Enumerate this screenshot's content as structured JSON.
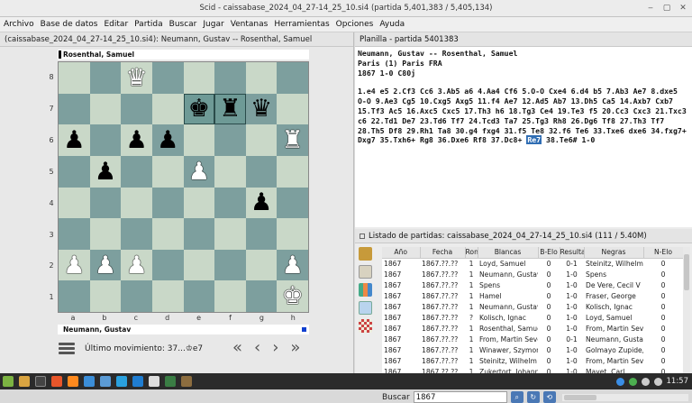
{
  "window": {
    "title": "Scid - caissabase_2024_04_27-14_25_10.si4 (partida 5,401,383 / 5,405,134)"
  },
  "menu": [
    "Archivo",
    "Base de datos",
    "Editar",
    "Partida",
    "Buscar",
    "Jugar",
    "Ventanas",
    "Herramientas",
    "Opciones",
    "Ayuda"
  ],
  "board_pane": {
    "tab": "(caissabase_2024_04_27-14_25_10.si4): Neumann, Gustav -- Rosenthal, Samuel",
    "black_player": "Rosenthal, Samuel",
    "white_player": "Neumann, Gustav",
    "ranks": [
      "8",
      "7",
      "6",
      "5",
      "4",
      "3",
      "2",
      "1"
    ],
    "files": [
      "a",
      "b",
      "c",
      "d",
      "e",
      "f",
      "g",
      "h"
    ],
    "last_move_label": "Último movimiento: 37...♔e7",
    "position": [
      [
        "",
        "",
        "wQ",
        "",
        "",
        "",
        "",
        ""
      ],
      [
        "",
        "",
        "",
        "",
        "bK",
        "bR",
        "bQ",
        ""
      ],
      [
        "bP",
        "",
        "bP",
        "bP",
        "",
        "",
        "",
        "wR"
      ],
      [
        "",
        "bP",
        "",
        "",
        "wP",
        "",
        "",
        ""
      ],
      [
        "",
        "",
        "",
        "",
        "",
        "",
        "bP",
        ""
      ],
      [
        "",
        "",
        "",
        "",
        "",
        "",
        "",
        ""
      ],
      [
        "wP",
        "wP",
        "wP",
        "",
        "",
        "",
        "",
        "wP"
      ],
      [
        "",
        "",
        "",
        "",
        "",
        "",
        "",
        "wK"
      ]
    ]
  },
  "notation": {
    "tab": "Planilla - partida 5401383",
    "players": "Neumann, Gustav  --  Rosenthal, Samuel",
    "event": "Paris (1)  Paris FRA",
    "year_result": "1867  1-0  C80j",
    "moves_before": "1.e4 e5 2.Cf3 Cc6 3.Ab5 a6 4.Aa4 Cf6 5.O-O Cxe4 6.d4 b5 7.Ab3 Ae7 8.dxe5 O-O 9.Ae3 Cg5 10.Cxg5 Axg5 11.f4 Ae7 12.Ad5 Ab7 13.Dh5 Ca5 14.Axb7 Cxb7 15.Tf3 Ac5 16.Axc5 Cxc5 17.Th3 h6 18.Tg3 Ce4 19.Te3 f5 20.Cc3 Cxc3 21.Txc3 c6 22.Td1 De7 23.Td6 Tf7 24.Tcd3 Ta7 25.Tg3 Rh8 26.Dg6 Tf8 27.Th3 Tf7 28.Th5 Df8 29.Rh1 Ta8 30.g4 fxg4 31.f5 Te8 32.f6 Te6 33.Txe6 dxe6 34.fxg7+ Dxg7 35.Txh6+ Rg8 36.Dxe6 Rf8 37.Dc8+ ",
    "current_move": "Re7",
    "moves_after": " 38.Te6# 1-0"
  },
  "game_list": {
    "tab": "Listado de partidas: caissabase_2024_04_27-14_25_10.si4 (111 / 5.40M)",
    "columns": [
      "Año",
      "Fecha",
      "Ron",
      "Blancas",
      "B-Elo",
      "Resulta",
      "Negras",
      "N-Elo"
    ],
    "rows": [
      [
        "1867",
        "1867.??.??",
        "1",
        "Loyd, Samuel",
        "0",
        "0-1",
        "Steinitz, Wilhelm",
        "0"
      ],
      [
        "1867",
        "1867.??.??",
        "1",
        "Neumann, Gustav",
        "0",
        "1-0",
        "Spens",
        "0"
      ],
      [
        "1867",
        "1867.??.??",
        "1",
        "Spens",
        "0",
        "1-0",
        "De Vere, Cecil V",
        "0"
      ],
      [
        "1867",
        "1867.??.??",
        "1",
        "Hamel",
        "0",
        "1-0",
        "Fraser, George",
        "0"
      ],
      [
        "1867",
        "1867.??.??",
        "1",
        "Neumann, Gustav",
        "0",
        "1-0",
        "Kolisch, Ignac",
        "0"
      ],
      [
        "1867",
        "1867.??.??",
        "?",
        "Kolisch, Ignac",
        "0",
        "1-0",
        "Loyd, Samuel",
        "0"
      ],
      [
        "1867",
        "1867.??.??",
        "1",
        "Rosenthal, Samuel",
        "0",
        "1-0",
        "From, Martin Sever",
        "0"
      ],
      [
        "1867",
        "1867.??.??",
        "1",
        "From, Martin Sever",
        "0",
        "0-1",
        "Neumann, Gustav",
        "0"
      ],
      [
        "1867",
        "1867.??.??",
        "1",
        "Winawer, Szymon",
        "0",
        "1-0",
        "Golmayo Zupide, C",
        "0"
      ],
      [
        "1867",
        "1867.??.??",
        "1",
        "Steinitz, Wilhelm",
        "0",
        "1-0",
        "From, Martin Sever",
        "0"
      ],
      [
        "1867",
        "1867.??.??",
        "1",
        "Zukertort, Johanne",
        "0",
        "1-0",
        "Mayet, Carl",
        "0"
      ]
    ]
  },
  "search": {
    "label": "Buscar",
    "value": "1867"
  },
  "clock": "11:57",
  "colors": {
    "board_light": "#c9d8c8",
    "board_dark": "#7d9f9e",
    "highlight": "#2f6db3"
  }
}
